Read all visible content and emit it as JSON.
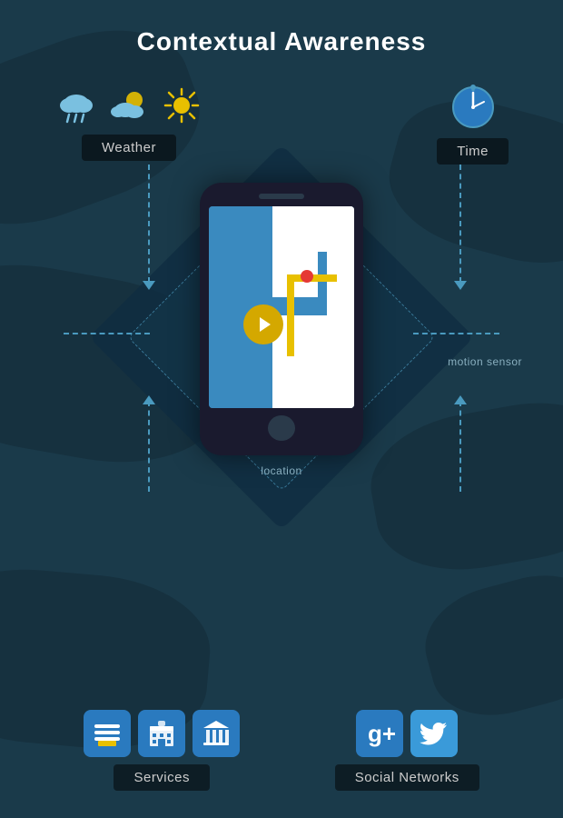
{
  "title": "Contextual Awareness",
  "top_left_label": "Weather",
  "top_right_label": "Time",
  "bottom_left_label": "Services",
  "bottom_right_label": "Social Networks",
  "float_label_location": "location",
  "float_label_motion": "motion sensor",
  "weather_icons": [
    "rain-cloud-icon",
    "partly-cloudy-icon",
    "sun-icon"
  ],
  "time_icon": "clock-icon",
  "services_icons": [
    "burger-shop-icon",
    "hotel-icon",
    "bank-icon"
  ],
  "social_icons": [
    "google-plus-icon",
    "twitter-icon"
  ],
  "colors": {
    "bg": "#1a3a4a",
    "accent_blue": "#2a7abf",
    "dashed_line": "#4a9abf",
    "label_bg": "rgba(0,0,0,0.5)",
    "label_text": "#cccccc",
    "route_yellow": "#e8c000",
    "location_red": "#e53935",
    "phone_dark": "#1a1a2e"
  }
}
